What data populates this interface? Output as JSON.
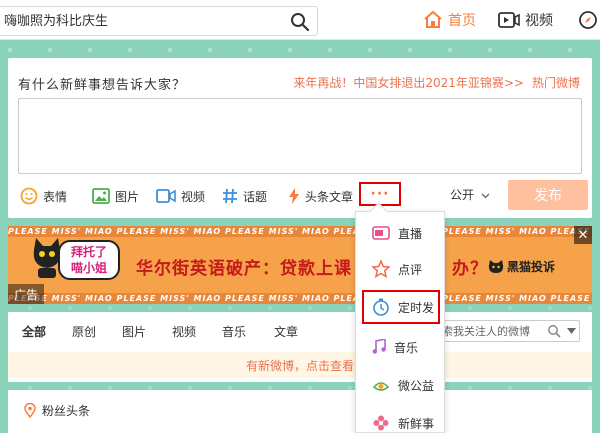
{
  "topbar": {
    "search_placeholder": "嗨咖照为科比庆生",
    "nav_home": "首页",
    "nav_video": "视频"
  },
  "publisher": {
    "prompt": "有什么新鲜事想告诉大家？",
    "hot_topic": "来年再战！中国女排退出2021年亚锦赛>>",
    "hot_weibo": "热门微博",
    "tools": {
      "emoji": "表情",
      "image": "图片",
      "video": "视频",
      "topic": "话题",
      "article": "头条文章"
    },
    "more": "···",
    "visibility": "公开",
    "publish": "发布"
  },
  "ad": {
    "strip_text": "PLEASE MISS' MIAO PLEASE MISS' MIAO PLEASE MISS' MIAO PLEASE MISS' MIAO PLEASE MISS' MIAO PLEASE MISS' MIAO PLEASE MISS' MIAO",
    "speech_line1": "拜托了",
    "speech_line2": "喵小姐",
    "headline": "华尔街英语破产：贷款上课",
    "headline_tail": "办？",
    "brand": "黑猫投诉",
    "label": "广告",
    "close": "✕"
  },
  "feed": {
    "tabs": [
      "全部",
      "原创",
      "图片",
      "视频",
      "音乐",
      "文章"
    ],
    "search_placeholder": "搜索我关注人的微博",
    "notice": "有新微博，点击查看"
  },
  "fans": {
    "title": "粉丝头条"
  },
  "dropdown": {
    "items": [
      "直播",
      "点评",
      "定时发",
      "音乐",
      "微公益",
      "新鲜事"
    ],
    "highlighted_index": 2
  },
  "colors": {
    "accent": "#fa7d3c",
    "link": "#eb7350",
    "publish_bg": "#ffc09f",
    "highlight_border": "#e00000"
  }
}
